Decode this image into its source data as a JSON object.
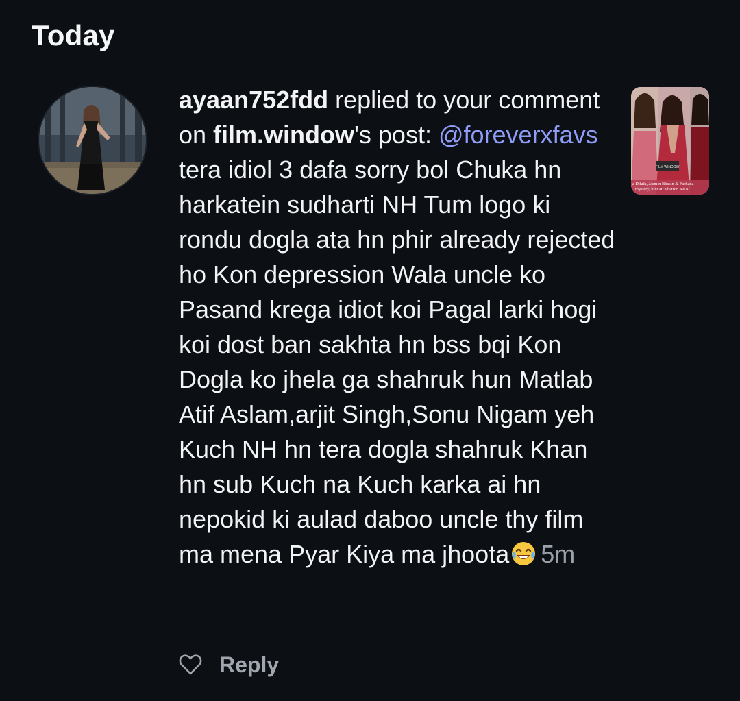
{
  "section": {
    "title": "Today"
  },
  "notification": {
    "username": "ayaan752fdd",
    "action_text": " replied to your comment on ",
    "post_owner": "film.window",
    "post_suffix": "'s post: ",
    "mention": "@foreverxfavs",
    "comment_text": " tera idiol 3 dafa sorry bol Chuka hn harkatein sudharti NH Tum logo ki rondu dogla ata hn phir already rejected ho Kon depression Wala uncle ko Pasand krega idiot koi Pagal larki hogi koi dost ban sakhta hn bss bqi Kon Dogla ko jhela ga shahruk hun Matlab Atif Aslam,arjit Singh,Sonu Nigam yeh Kuch NH hn tera dogla shahruk Khan hn sub Kuch na Kuch karka ai hn nepokid ki aulad daboo uncle thy film ma mena Pyar Kiya ma jhoota",
    "emoji": "face-with-tears-of-joy",
    "timestamp": "5m"
  },
  "thumbnail": {
    "caption_line1": "a Dilaik, Jasmin Bhasin & Farhana",
    "caption_line2": "mystery, hint at 'Khatron Ke K",
    "logo_text": "FILM WINDOW"
  },
  "actions": {
    "like_icon": "heart-outline-icon",
    "reply_label": "Reply"
  },
  "colors": {
    "background": "#0c0f14",
    "text": "#f2f3f5",
    "mention": "#8f9cf8",
    "muted": "#9aa0a8"
  }
}
